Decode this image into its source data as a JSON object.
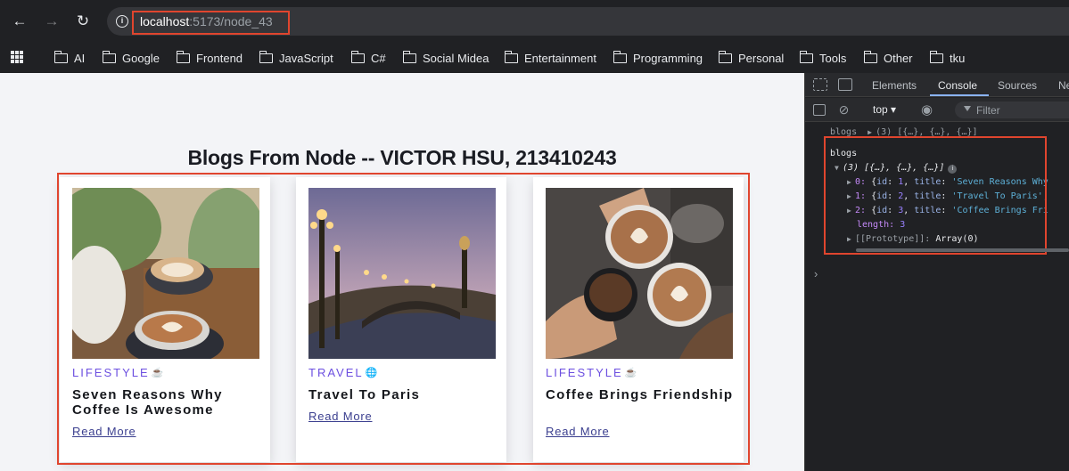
{
  "browser": {
    "url_host": "localhost",
    "url_path": ":5173/node_43"
  },
  "bookmarks": [
    {
      "label": "AI"
    },
    {
      "label": "Google"
    },
    {
      "label": "Frontend"
    },
    {
      "label": "JavaScript"
    },
    {
      "label": "C#"
    },
    {
      "label": "Social Midea"
    },
    {
      "label": "Entertainment"
    },
    {
      "label": "Programming"
    },
    {
      "label": "Personal"
    },
    {
      "label": "Tools"
    },
    {
      "label": "Other"
    },
    {
      "label": "tku"
    }
  ],
  "page": {
    "title": "Blogs From Node -- VICTOR HSU, 213410243",
    "cards": [
      {
        "category": "LIFESTYLE",
        "category_icon": "coffee-cup-icon",
        "title": "Seven Reasons Why Coffee Is Awesome",
        "link": "Read More"
      },
      {
        "category": "TRAVEL",
        "category_icon": "globe-icon",
        "title": "Travel To Paris",
        "link": "Read More"
      },
      {
        "category": "LIFESTYLE",
        "category_icon": "coffee-cup-icon",
        "title": "Coffee Brings Friendship",
        "link": "Read More"
      }
    ]
  },
  "devtools": {
    "tabs": [
      "Elements",
      "Console",
      "Sources",
      "Ne"
    ],
    "active_tab": "Console",
    "context": "top",
    "filter_placeholder": "Filter",
    "console": {
      "collapsed_label": "blogs",
      "collapsed_value": "(3) [{…}, {…}, {…}]",
      "label": "blogs",
      "array_summary": "(3) [{…}, {…}, {…}]",
      "items": [
        {
          "index": "0:",
          "id": "1",
          "title": "'Seven Reasons Why"
        },
        {
          "index": "1:",
          "id": "2",
          "title": "'Travel To Paris',"
        },
        {
          "index": "2:",
          "id": "3",
          "title": "'Coffee Brings Fri"
        }
      ],
      "length_key": "length:",
      "length_value": "3",
      "prototype_key": "[[Prototype]]:",
      "prototype_value": "Array(0)"
    }
  },
  "colors": {
    "highlight": "#e0452e",
    "category": "#6c4fe0",
    "page_bg": "#f3f4f7",
    "devtools_bg": "#202124"
  }
}
